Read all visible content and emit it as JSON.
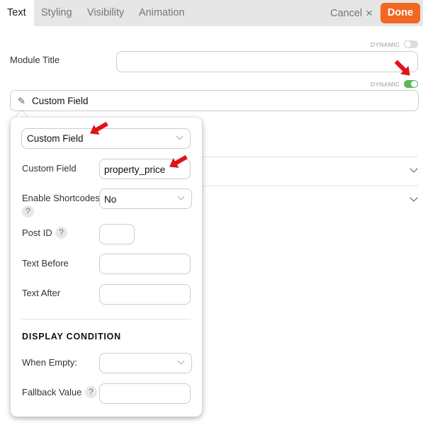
{
  "tabs": [
    {
      "label": "Text",
      "active": true
    },
    {
      "label": "Styling",
      "active": false
    },
    {
      "label": "Visibility",
      "active": false
    },
    {
      "label": "Animation",
      "active": false
    }
  ],
  "header": {
    "cancel_label": "Cancel",
    "cancel_icon": "×",
    "done_label": "Done",
    "accent": "#f26722"
  },
  "module_title": {
    "dynamic_label": "DYNAMIC",
    "dynamic_on": false,
    "label": "Module Title",
    "value": ""
  },
  "text_field": {
    "dynamic_label": "DYNAMIC",
    "dynamic_on": true,
    "toggle_color": "#5cb85c",
    "pencil_icon": "✎",
    "value": "Custom Field"
  },
  "popup": {
    "source_select": "Custom Field",
    "fields": [
      {
        "label": "Custom Field",
        "value": "property_price",
        "type": "text"
      },
      {
        "label": "Enable Shortcodes",
        "value": "No",
        "type": "select",
        "help": "?"
      },
      {
        "label": "Post ID",
        "value": "",
        "type": "text",
        "help": "?"
      },
      {
        "label": "Text Before",
        "value": "",
        "type": "text"
      },
      {
        "label": "Text After",
        "value": "",
        "type": "text"
      }
    ],
    "section_title": "DISPLAY CONDITION",
    "condition_fields": [
      {
        "label": "When Empty:",
        "value": "",
        "type": "select"
      },
      {
        "label": "Fallback Value",
        "value": "",
        "type": "text",
        "help": "?"
      }
    ]
  },
  "annotation_color": "#e0121b"
}
